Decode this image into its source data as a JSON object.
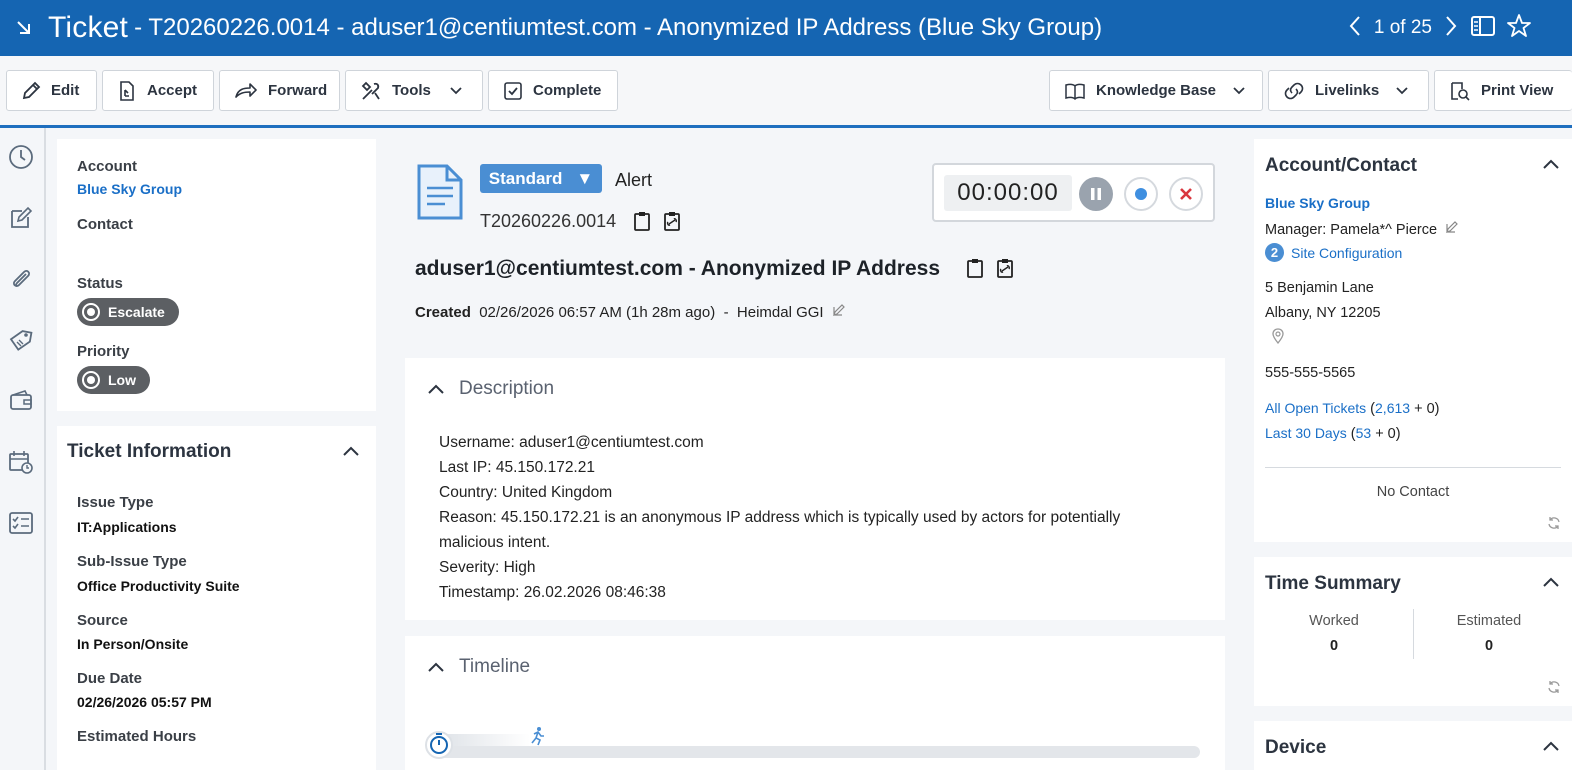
{
  "title": {
    "app": "Ticket",
    "detail": "- T20260226.0014 - aduser1@centiumtest.com - Anonymized IP Address (Blue Sky Group)",
    "pager": "1 of 25"
  },
  "toolbar": {
    "edit": "Edit",
    "accept": "Accept",
    "forward": "Forward",
    "tools": "Tools",
    "complete": "Complete",
    "knowledge_base": "Knowledge Base",
    "livelinks": "Livelinks",
    "print_view": "Print View"
  },
  "left": {
    "account_label": "Account",
    "account_value": "Blue Sky Group",
    "contact_label": "Contact",
    "status_label": "Status",
    "status_value": "Escalate",
    "priority_label": "Priority",
    "priority_value": "Low",
    "ticket_info_title": "Ticket Information",
    "fields": [
      {
        "label": "Issue Type",
        "value": "IT:Applications"
      },
      {
        "label": "Sub-Issue Type",
        "value": "Office Productivity Suite"
      },
      {
        "label": "Source",
        "value": "In Person/Onsite"
      },
      {
        "label": "Due Date",
        "value": "02/26/2026 05:57 PM"
      },
      {
        "label": "Estimated Hours",
        "value": ""
      }
    ]
  },
  "center": {
    "category": "Standard",
    "alert": "Alert",
    "ticket_id": "T20260226.0014",
    "heading": "aduser1@centiumtest.com - Anonymized IP Address",
    "created_label": "Created",
    "created_value": "02/26/2026 06:57 AM (1h 28m ago)",
    "created_sep": "-",
    "created_by": "Heimdal GGI",
    "timer": "00:00:00",
    "description_title": "Description",
    "description_lines": [
      "Username: aduser1@centiumtest.com",
      "Last IP: 45.150.172.21",
      "Country: United Kingdom",
      "Reason: 45.150.172.21 is an anonymous IP address which is typically used by actors for potentially",
      "malicious intent.",
      "Severity: High",
      "Timestamp: 26.02.2026 08:46:38"
    ],
    "timeline_title": "Timeline"
  },
  "right": {
    "account_contact_title": "Account/Contact",
    "account_name": "Blue Sky Group",
    "manager": "Manager: Pamela*^ Pierce",
    "site_badge": "2",
    "site_config": "Site Configuration",
    "address1": "5 Benjamin Lane",
    "address2": "Albany, NY 12205",
    "phone": "555-555-5565",
    "open_tickets_label": "All Open Tickets",
    "open_tickets_count": "2,613",
    "open_tickets_extra": "+ 0)",
    "last30_label": "Last 30 Days",
    "last30_count": "53",
    "last30_extra": "+ 0)",
    "no_contact": "No Contact",
    "time_summary_title": "Time Summary",
    "worked_label": "Worked",
    "worked_value": "0",
    "estimated_label": "Estimated",
    "estimated_value": "0",
    "device_title": "Device"
  },
  "colors": {
    "brand": "#1565b2",
    "link": "#1a6fc7",
    "pill": "#5c5f63",
    "category": "#4a8ed3",
    "stop": "#d9363e"
  }
}
